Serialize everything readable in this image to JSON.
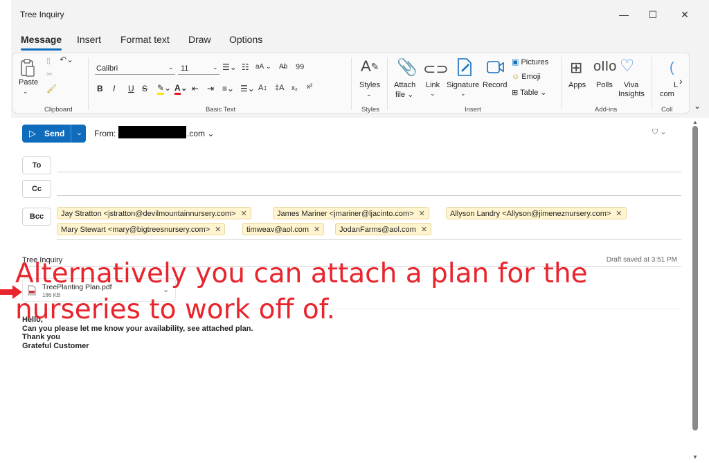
{
  "window": {
    "title": "Tree Inquiry",
    "minimize": "—",
    "maximize": "☐",
    "close": "✕"
  },
  "tabs": [
    {
      "label": "Message",
      "active": true
    },
    {
      "label": "Insert"
    },
    {
      "label": "Format text"
    },
    {
      "label": "Draw"
    },
    {
      "label": "Options"
    }
  ],
  "ribbon": {
    "clipboard": {
      "paste": "Paste",
      "group": "Clipboard"
    },
    "basic_text": {
      "font": "Calibri",
      "size": "11",
      "group": "Basic Text"
    },
    "styles": {
      "label": "Styles",
      "group": "Styles"
    },
    "insert": {
      "attach": "Attach",
      "attach2": "file",
      "link": "Link",
      "signature": "Signature",
      "record": "Record",
      "pictures": "Pictures",
      "emoji": "Emoji",
      "table": "Table",
      "group": "Insert"
    },
    "addins": {
      "apps": "Apps",
      "polls": "Polls",
      "viva": "Viva",
      "viva2": "Insights",
      "group": "Add-ins"
    },
    "overflow": {
      "label1": "L",
      "label2": "com",
      "group": "Coll"
    }
  },
  "compose": {
    "send_label": "Send",
    "from_label": "From:",
    "from_domain": ".com",
    "to_label": "To",
    "cc_label": "Cc",
    "bcc_label": "Bcc",
    "bcc_recipients": [
      "Jay Stratton <jstratton@devilmountainnursery.com>",
      "James Mariner <jmariner@ljacinto.com>",
      "Allyson Landry <Allyson@jimeneznursery.com>",
      "Mary Stewart <mary@bigtreesnursery.com>",
      "timweav@aol.com",
      "JodanFarms@aol.com"
    ],
    "subject": "Tree Inquiry",
    "draft_status": "Draft saved at 3:51 PM",
    "attachment": {
      "name": "TreePlanting Plan.pdf",
      "size": "186 KB"
    },
    "body_lines": [
      "Hello,",
      "Can you please let me know your availability, see attached plan.",
      "Thank you",
      "Grateful Customer"
    ]
  },
  "annotation": {
    "line1": "Alternatively you can attach a plan for the",
    "line2": "nurseries to work off of.",
    "color": "#e8242d"
  },
  "colors": {
    "accent": "#0f6cbd",
    "chip_bg": "#fff4ce"
  }
}
